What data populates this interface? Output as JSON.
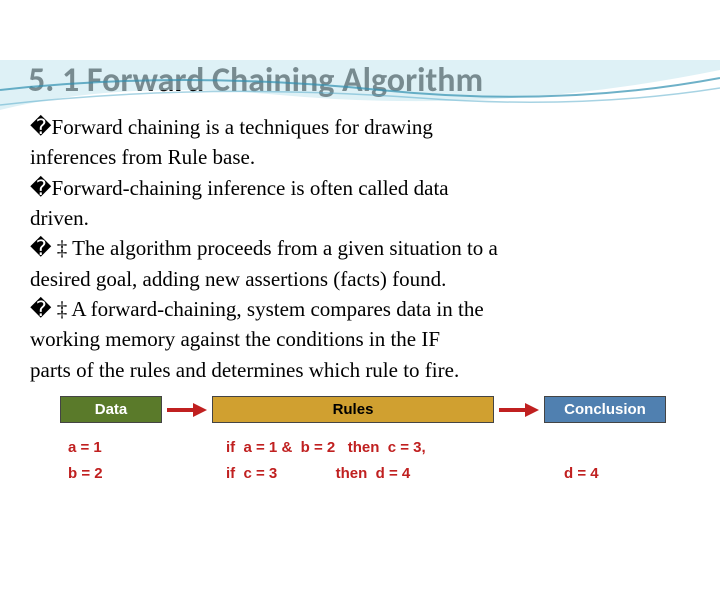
{
  "title": "5. 1 Forward Chaining Algorithm",
  "bullets": {
    "b1a": "�Forward chaining is a techniques for drawing",
    "b1b": "inferences from Rule base.",
    "b2a": "�Forward-chaining inference is often called data",
    "b2b": "driven.",
    "b3a": "� ‡ The algorithm proceeds from a given situation to a",
    "b3b": "desired goal, adding new assertions (facts) found.",
    "b4a": "� ‡ A forward-chaining, system compares data in the",
    "b4b": "working memory against the conditions in the IF",
    "b4c": "parts of the rules and determines which rule to fire."
  },
  "diagram": {
    "headers": {
      "data": "Data",
      "rules": "Rules",
      "conclusion": "Conclusion"
    },
    "data_vals": {
      "a": "a = 1",
      "b": "b = 2"
    },
    "rules_vals": {
      "r1": "if  a = 1 &  b = 2   then  c = 3,",
      "r2": "if  c = 3              then  d = 4"
    },
    "conclusion_val": "d = 4"
  }
}
